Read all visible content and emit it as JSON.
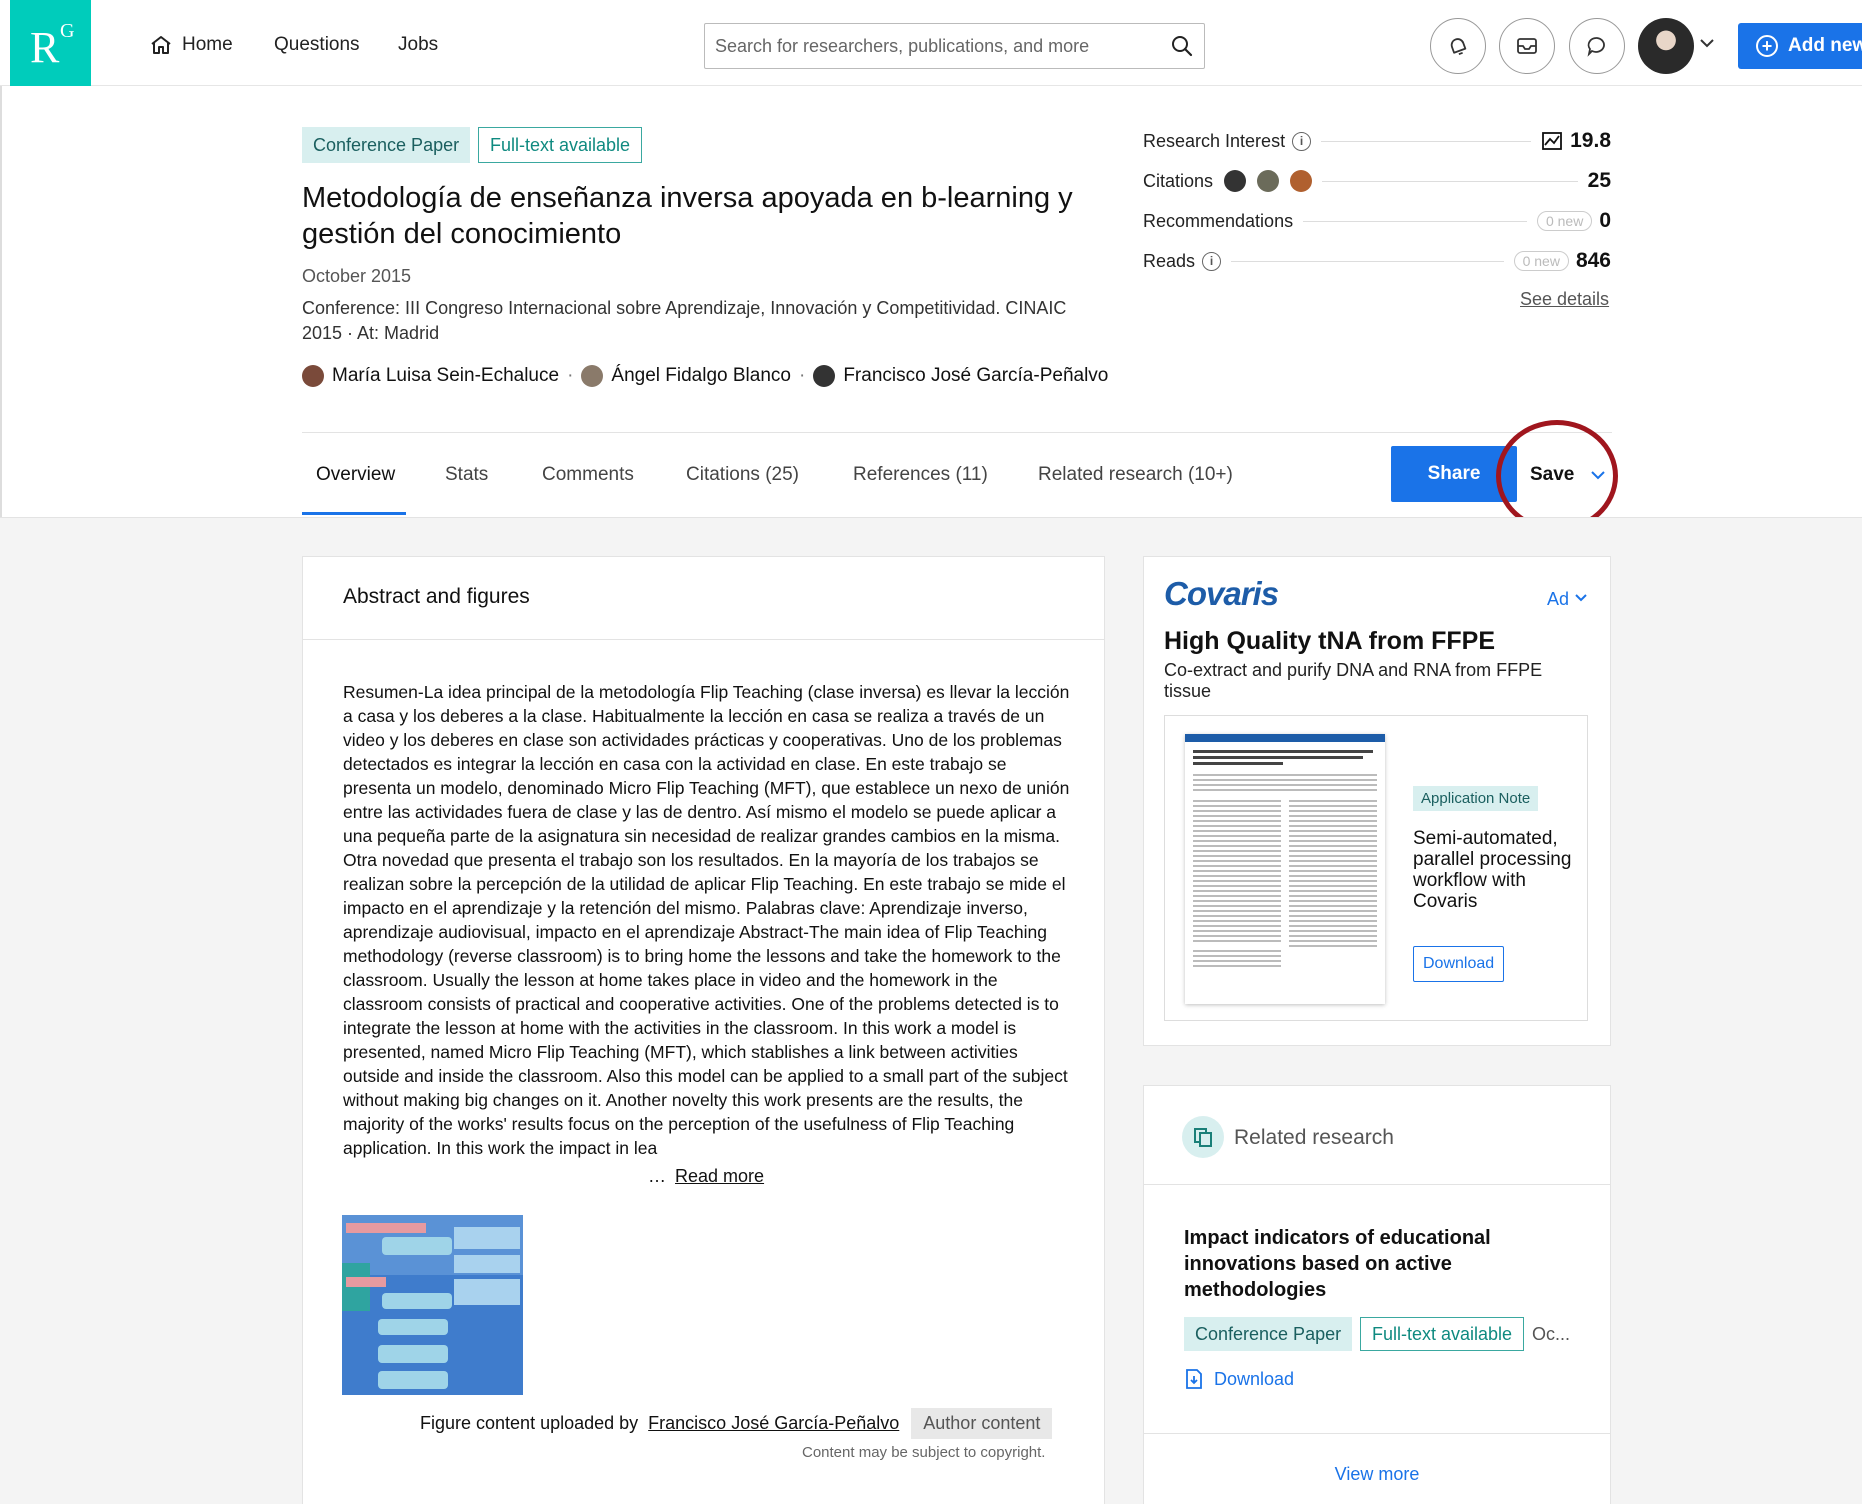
{
  "nav": {
    "logo_main": "R",
    "logo_sup": "G",
    "home": "Home",
    "questions": "Questions",
    "jobs": "Jobs",
    "search_placeholder": "Search for researchers, publications, and more",
    "add_new": "Add new",
    "icons": [
      "home-icon",
      "search-icon",
      "notifications-icon",
      "messages-icon",
      "chat-icon",
      "chevron-down-icon",
      "plus-icon"
    ]
  },
  "paper": {
    "type_tag": "Conference Paper",
    "fulltext_tag": "Full-text available",
    "title": "Metodología de enseñanza inversa apoyada en b-learning y gestión del conocimiento",
    "date": "October 2015",
    "conference": "Conference: III Congreso Internacional sobre Aprendizaje, Innovación y Competitividad. CINAIC 2015 · At: Madrid",
    "authors": [
      {
        "name": "María Luisa Sein-Echaluce",
        "color": "#7a4a3a"
      },
      {
        "name": "Ángel Fidalgo Blanco",
        "color": "#8a7a6a"
      },
      {
        "name": "Francisco José García-Peñalvo",
        "color": "#333333"
      }
    ],
    "author_sep": "·"
  },
  "stats": {
    "research_interest_label": "Research Interest",
    "research_interest_value": "19.8",
    "citations_label": "Citations",
    "citations_value": "25",
    "recommendations_label": "Recommendations",
    "recommendations_new": "0 new",
    "recommendations_value": "0",
    "reads_label": "Reads",
    "reads_new": "0 new",
    "reads_value": "846",
    "see_details": "See details",
    "info_glyph": "i"
  },
  "tabs": {
    "overview": "Overview",
    "stats": "Stats",
    "comments": "Comments",
    "citations": "Citations (25)",
    "references": "References (11)",
    "related": "Related research (10+)",
    "share": "Share",
    "save": "Save"
  },
  "abstract": {
    "heading": "Abstract and figures",
    "text": "Resumen-La idea principal de la metodología Flip Teaching (clase inversa) es llevar la lección a casa y los deberes a la clase. Habitualmente la lección en casa se realiza a través de un video y los deberes en clase son actividades prácticas y cooperativas. Uno de los problemas detectados es integrar la lección en casa con la actividad en clase. En este trabajo se presenta un modelo, denominado Micro Flip Teaching (MFT), que establece un nexo de unión entre las actividades fuera de clase y las de dentro. Así mismo el modelo se puede aplicar a una pequeña parte de la asignatura sin necesidad de realizar grandes cambios en la misma. Otra novedad que presenta el trabajo son los resultados. En la mayoría de los trabajos se realizan sobre la percepción de la utilidad de aplicar Flip Teaching. En este trabajo se mide el impacto en el aprendizaje y la retención del mismo. Palabras clave: Aprendizaje inverso, aprendizaje audiovisual, impacto en el aprendizaje Abstract-The main idea of Flip Teaching methodology (reverse classroom) is to bring home the lessons and take the homework to the classroom. Usually the lesson at home takes place in video and the homework in the classroom consists of practical and cooperative activities. One of the problems detected is to integrate the lesson at home with the activities in the classroom. In this work a model is presented, named Micro Flip Teaching (MFT), which stablishes a link between activities outside and inside the classroom. Also this model can be applied to a small part of the subject without making big changes on it. Another novelty this work presents are the results, the majority of the works' results focus on the perception of the usefulness of Flip Teaching application. In this work the impact in lea",
    "ellipsis": "…",
    "read_more": "Read more",
    "figure_caption_prefix": "Figure content uploaded by",
    "figure_uploader": "Francisco José García-Peñalvo",
    "author_content": "Author content",
    "copyright": "Content may be subject to copyright."
  },
  "ad": {
    "brand": "Covaris",
    "ad_label": "Ad",
    "headline": "High Quality tNA from FFPE",
    "subtitle": "Co-extract and purify DNA and RNA from FFPE tissue",
    "note_tag": "Application Note",
    "description": "Semi-automated, parallel processing workflow with Covaris",
    "download": "Download"
  },
  "related": {
    "heading": "Related research",
    "item_title": "Impact indicators of educational innovations based on active methodologies",
    "item_type": "Conference Paper",
    "item_fulltext": "Full-text available",
    "item_date_trunc": "Oc...",
    "item_download": "Download",
    "view_more": "View more"
  }
}
